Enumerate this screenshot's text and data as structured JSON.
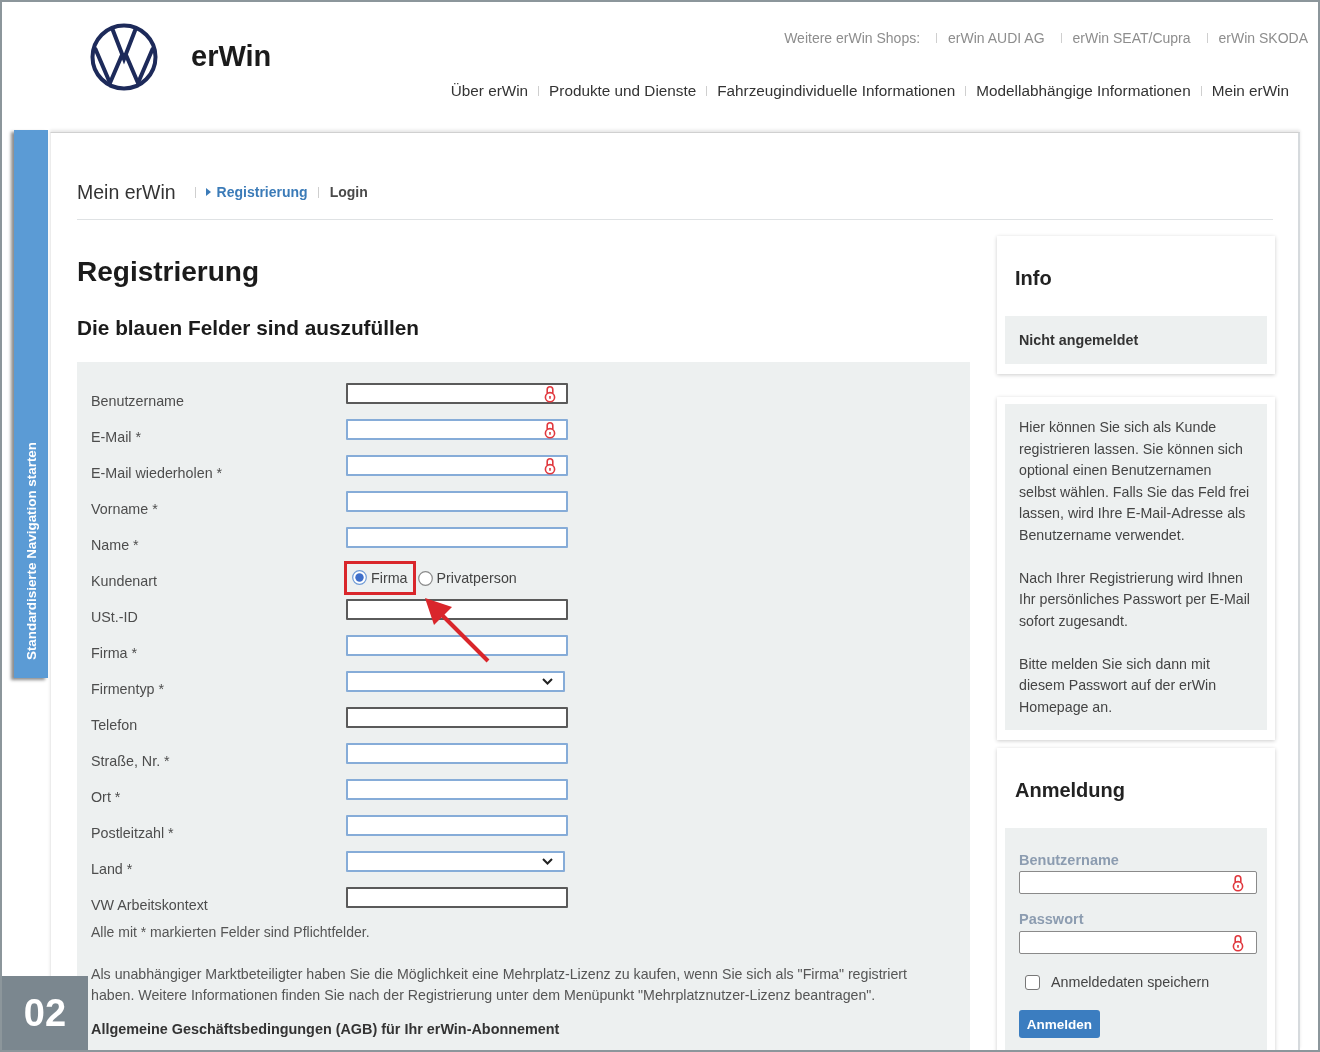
{
  "header": {
    "brand": "erWin",
    "shops_label": "Weitere erWin Shops:",
    "shops": [
      "erWin AUDI AG",
      "erWin SEAT/Cupra",
      "erWin SKODA"
    ],
    "nav": [
      "Über erWin",
      "Produkte und Dienste",
      "Fahrzeugindividuelle Informationen",
      "Modellabhängige Informationen",
      "Mein erWin"
    ]
  },
  "side_tab": {
    "label": "Standardisierte Navigation starten"
  },
  "breadcrumb": {
    "section": "Mein erWin",
    "items": [
      {
        "label": "Registrierung",
        "selected": true
      },
      {
        "label": "Login",
        "selected": false
      }
    ]
  },
  "heading": {
    "title": "Registrierung",
    "subtitle": "Die blauen Felder sind auszufüllen"
  },
  "form": {
    "fields": [
      {
        "label": "Benutzername",
        "kind": "text",
        "required": false,
        "lock": true
      },
      {
        "label": "E-Mail *",
        "kind": "text",
        "required": true,
        "lock": true
      },
      {
        "label": "E-Mail wiederholen *",
        "kind": "text",
        "required": true,
        "lock": true
      },
      {
        "label": "Vorname *",
        "kind": "text",
        "required": true,
        "lock": false
      },
      {
        "label": "Name *",
        "kind": "text",
        "required": true,
        "lock": false
      },
      {
        "label": "Kundenart",
        "kind": "radio",
        "options": [
          {
            "label": "Firma",
            "selected": true,
            "highlighted": true
          },
          {
            "label": "Privatperson",
            "selected": false,
            "highlighted": false
          }
        ]
      },
      {
        "label": "USt.-ID",
        "kind": "text",
        "required": false,
        "lock": false
      },
      {
        "label": "Firma *",
        "kind": "text",
        "required": true,
        "lock": false
      },
      {
        "label": "Firmentyp *",
        "kind": "select",
        "required": true
      },
      {
        "label": "Telefon",
        "kind": "text",
        "required": false,
        "lock": false
      },
      {
        "label": "Straße, Nr. *",
        "kind": "text",
        "required": true,
        "lock": false
      },
      {
        "label": "Ort *",
        "kind": "text",
        "required": true,
        "lock": false
      },
      {
        "label": "Postleitzahl *",
        "kind": "text",
        "required": true,
        "lock": false
      },
      {
        "label": "Land *",
        "kind": "select",
        "required": true
      },
      {
        "label": "VW Arbeitskontext",
        "kind": "text",
        "required": false,
        "lock": false
      }
    ],
    "required_note": "Alle mit * markierten Felder sind Pflichtfelder.",
    "license_note": "Als unabhängiger Marktbeteiligter haben Sie die Möglichkeit eine Mehrplatz-Lizenz zu kaufen, wenn Sie sich als \"Firma\" registriert haben. Weitere Informationen finden Sie nach der Registrierung unter dem Menüpunkt \"Mehrplatznutzer-Lizenz beantragen\".",
    "terms_heading": "Allgemeine Geschäftsbedingungen (AGB) für Ihr erWin-Abonnement"
  },
  "sidebar": {
    "info": {
      "title": "Info",
      "status": "Nicht angemeldet"
    },
    "help": [
      "Hier können Sie sich als Kunde registrieren lassen. Sie können sich optional einen Benutzernamen selbst wählen. Falls Sie das Feld frei lassen, wird Ihre E-Mail-Adresse als Benutzername verwendet.",
      "Nach Ihrer Registrierung wird Ihnen Ihr persönliches Passwort per E-Mail sofort zugesandt.",
      "Bitte melden Sie sich dann mit diesem Passwort auf der erWin Homepage an."
    ],
    "login": {
      "title": "Anmeldung",
      "fields": [
        {
          "label": "Benutzername",
          "lock": true
        },
        {
          "label": "Passwort",
          "lock": true
        }
      ],
      "remember": {
        "label": "Anmeldedaten speichern",
        "checked": false
      },
      "submit": "Anmelden"
    }
  },
  "figure_number": "02"
}
